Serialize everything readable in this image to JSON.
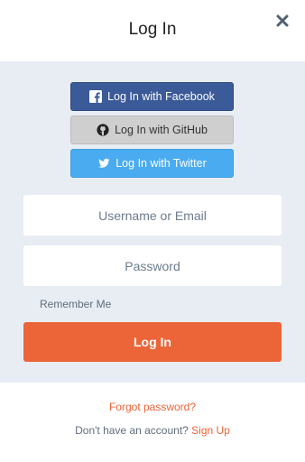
{
  "dialog": {
    "title": "Log In"
  },
  "social": {
    "facebook_label": "Log In with Facebook",
    "github_label": "Log In with GitHub",
    "twitter_label": "Log In with Twitter"
  },
  "form": {
    "username_placeholder": "Username or Email",
    "password_placeholder": "Password",
    "remember_label": "Remember Me",
    "submit_label": "Log In"
  },
  "footer": {
    "forgot_label": "Forgot password?",
    "no_account_text": "Don't have an account?",
    "signup_label": "Sign Up"
  },
  "colors": {
    "accent": "#ec6538",
    "facebook": "#3b5a98",
    "github": "#cfcfcf",
    "twitter": "#4aabf0",
    "panel_bg": "#e8edf4"
  },
  "icons": {
    "close": "close-icon",
    "facebook": "facebook-icon",
    "github": "github-icon",
    "twitter": "twitter-icon"
  }
}
